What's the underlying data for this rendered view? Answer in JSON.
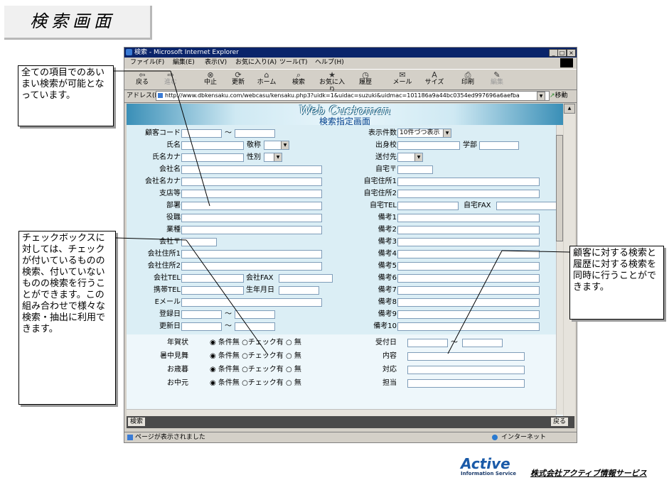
{
  "slide": {
    "title": "検索画面",
    "callouts": [
      "全ての項目でのあいまい検索が可能となっています。",
      "チェックボックスに対しては、チェックが付いているものの検索、付いていないものの検索を行うことができます。この組み合わせで様々な検索・抽出に利用できます。",
      "顧客に対する検索と履歴に対する検索を同時に行うことができます。"
    ],
    "company": "株式会社アクティブ情報サービス",
    "logo_main": "Active",
    "logo_sub": "Information Service"
  },
  "browser": {
    "title": "検索 - Microsoft Internet Explorer",
    "menu": [
      "ファイル(F)",
      "編集(E)",
      "表示(V)",
      "お気に入り(A)",
      "ツール(T)",
      "ヘルプ(H)"
    ],
    "toolbar": [
      "戻る",
      "進む",
      "中止",
      "更新",
      "ホーム",
      "検索",
      "お気に入り",
      "履歴",
      "メール",
      "サイズ",
      "印刷",
      "編集"
    ],
    "address_label": "アドレス(D)",
    "address": "http://www.dbkensaku.com/webcasu/kensaku.php3?uidk=1&uidac=suzuki&uidmac=101186a9a44bc0354ed997696a6aefba",
    "go_label": "移動",
    "status": "ページが表示されました",
    "zone": "インターネット"
  },
  "page": {
    "banner_title": "Web Customan",
    "banner_subtitle": "検索指定画面",
    "tilde": "～",
    "left_labels": [
      "顧客コード",
      "氏名",
      "氏名カナ",
      "会社名",
      "会社名カナ",
      "支店等",
      "部署",
      "役職",
      "業種",
      "会社〒",
      "会社住所1",
      "会社住所2",
      "会社TEL",
      "携帯TEL",
      "Eメール",
      "登録日",
      "更新日"
    ],
    "keisho_label": "敬称",
    "seibetsu_label": "性別",
    "company_fax_label": "会社FAX",
    "birthday_label": "生年月日",
    "right_labels": [
      "表示件数",
      "出身校",
      "送付先",
      "自宅〒",
      "自宅住所1",
      "自宅住所2",
      "自宅TEL",
      "備考1",
      "備考2",
      "備考3",
      "備考4",
      "備考5",
      "備考6",
      "備考7",
      "備考8",
      "備考9",
      "備考10"
    ],
    "display_count": "10件づつ表示",
    "gakubu_label": "学部",
    "home_fax_label": "自宅FAX",
    "check_rows": [
      "年賀状",
      "暑中見舞",
      "お歳暮",
      "お中元"
    ],
    "radio_options": [
      "条件無",
      "チェック有",
      "無"
    ],
    "history_labels": [
      "受付日",
      "内容",
      "対応",
      "担当"
    ],
    "search_button": "検索",
    "back_button": "戻る"
  }
}
